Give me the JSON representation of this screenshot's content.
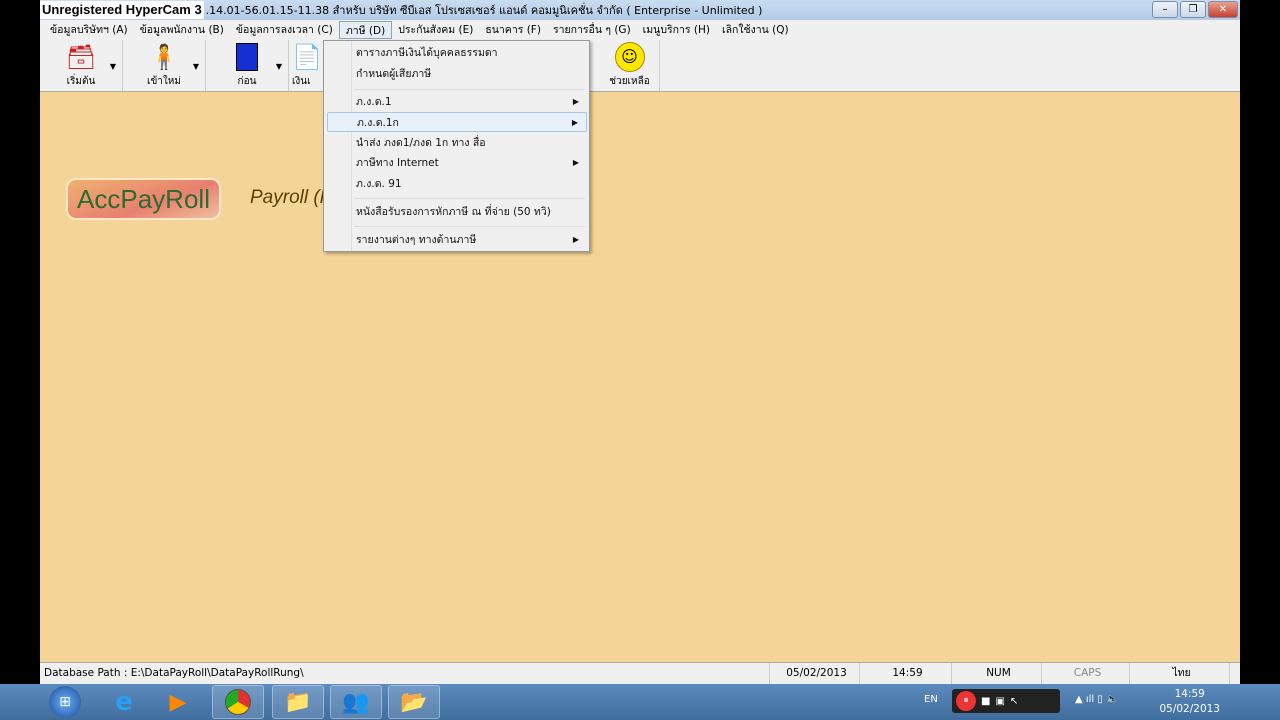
{
  "watermark": "Unregistered HyperCam 3",
  "window": {
    "title": ".14.01-56.01.15-11.38  สำหรับ บริษัท ซีบีเอส โปรเซสเซอร์ แอนด์ คอมมูนิเคชั่น จำกัด  ( Enterprise - Unlimited )",
    "minimize": "–",
    "maximize": "❐",
    "close": "✕"
  },
  "menubar": [
    "ข้อมูลบริษัทฯ (A)",
    "ข้อมูลพนักงาน (B)",
    "ข้อมูลการลงเวลา (C)",
    "ภาษี (D)",
    "ประกันสังคม (E)",
    "ธนาคาร (F)",
    "รายการอื่น ๆ (G)",
    "เมนูบริการ (H)",
    "เลิกใช้งาน (Q)"
  ],
  "toolbar": [
    {
      "label": "เริ่มต้น",
      "icon": "cash-register-icon"
    },
    {
      "label": "เข้าใหม่",
      "icon": "person-icon"
    },
    {
      "label": "ก่อน",
      "icon": "book-icon"
    },
    {
      "label": "เงินเ",
      "icon": "document-icon"
    },
    {
      "label": "",
      "icon": ""
    },
    {
      "label": "",
      "icon": ""
    },
    {
      "label": "",
      "icon": ""
    },
    {
      "label": "ช่วยเหลือ",
      "icon": "smiley-icon"
    }
  ],
  "logo": "AccPayRoll",
  "subtitle": "Payroll (P",
  "tax_menu": [
    {
      "label": "ตารางภาษีเงินได้บุคคลธรรมดา",
      "submenu": false
    },
    {
      "label": "กำหนดผู้เสียภาษี",
      "submenu": false
    },
    {
      "label": "ภ.ง.ด.1",
      "submenu": true
    },
    {
      "label": "ภ.ง.ด.1ก",
      "submenu": true,
      "highlighted": true
    },
    {
      "label": "นำส่ง ภงด1/ภงด 1ก ทาง สื่อ",
      "submenu": false
    },
    {
      "label": "ภาษีทาง Internet",
      "submenu": true
    },
    {
      "label": "ภ.ง.ด. 91",
      "submenu": false
    },
    {
      "label": "หนังสือรับรองการหักภาษี ณ ที่จ่าย (50 ทวิ)",
      "submenu": false
    },
    {
      "label": "รายงานต่างๆ ทางด้านภาษี",
      "submenu": true
    }
  ],
  "status": {
    "db": "Database Path :   E:\\DataPayRoll\\DataPayRollRung\\",
    "date": "05/02/2013",
    "time": "14:59",
    "num": "NUM",
    "caps": "CAPS",
    "lang": "ไทย"
  },
  "taskbar": {
    "lang": "EN",
    "time": "14:59",
    "date": "05/02/2013"
  }
}
